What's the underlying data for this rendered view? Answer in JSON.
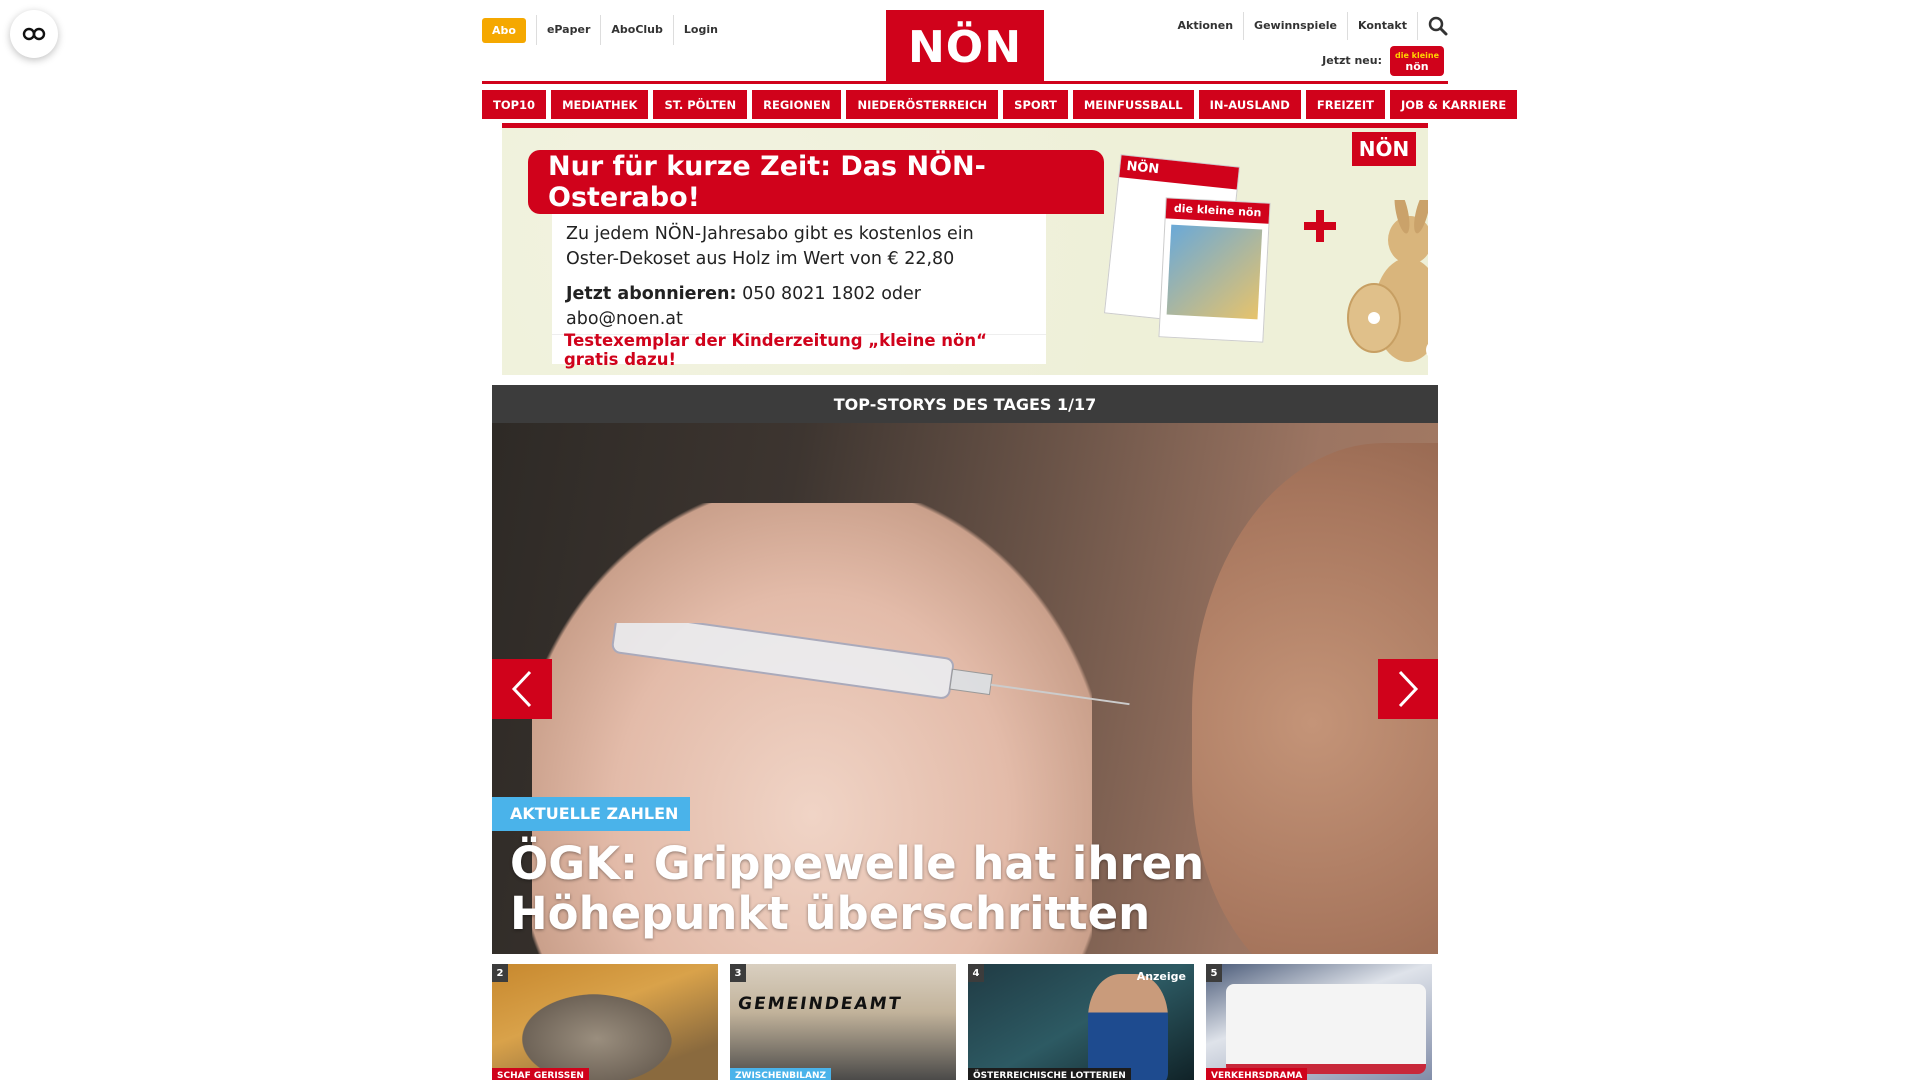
{
  "header": {
    "abo_label": "Abo",
    "top_links": [
      "ePaper",
      "AboClub",
      "Login"
    ],
    "logo_text": "NÖN",
    "right_links": [
      "Aktionen",
      "Gewinnspiele",
      "Kontakt"
    ],
    "jetzt_neu": "Jetzt neu:",
    "kn_badge_small": "die kleine",
    "kn_badge_big": "nön"
  },
  "nav": {
    "items": [
      "TOP10",
      "MEDIATHEK",
      "ST. PÖLTEN",
      "REGIONEN",
      "NIEDERÖSTERREICH",
      "SPORT",
      "MEINFUSSBALL",
      "IN-AUSLAND",
      "FREIZEIT",
      "JOB & KARRIERE"
    ]
  },
  "ad": {
    "headline": "Nur für kurze Zeit: Das NÖN-Osterabo!",
    "line1": "Zu jedem NÖN-Jahresabo gibt es kostenlos ein",
    "line2": "Oster-Dekoset aus Holz im Wert von € 22,80",
    "cta_bold": "Jetzt abonnieren:",
    "cta_rest": " 050 8021 1802 oder abo@noen.at",
    "footer": "Testexemplar der Kinderzeitung „kleine nön“ gratis dazu!",
    "logo": "NÖN",
    "paper1_head": "NÖN",
    "paper2_head": "die kleine nön"
  },
  "slider": {
    "header": "TOP-STORYS DES TAGES 1/17",
    "category": "AKTUELLE ZAHLEN",
    "headline": "ÖGK: Grippewelle hat ihren Höhepunkt überschritten"
  },
  "thumbs": [
    {
      "num": "2",
      "tag": "SCHAF GERISSEN",
      "tag_color": "#d0021b"
    },
    {
      "num": "3",
      "tag": "ZWISCHENBILANZ",
      "tag_color": "#4ab3ea",
      "overlay": "GEMEINDEAMT"
    },
    {
      "num": "4",
      "tag": "ÖSTERREICHISCHE LOTTERIEN",
      "tag_color": "#1c1c1c",
      "anzeige": "Anzeige"
    },
    {
      "num": "5",
      "tag": "VERKEHRSDRAMA",
      "tag_color": "#d0021b"
    }
  ],
  "colors": {
    "brand_red": "#d0021b",
    "abo_orange": "#f5a800",
    "accent_blue": "#4ab3ea",
    "dark_bar": "#3c3c3c"
  },
  "icons": [
    "accessibility-toggle-icon",
    "search-icon",
    "chevron-left-icon",
    "chevron-right-icon",
    "plus-icon"
  ]
}
